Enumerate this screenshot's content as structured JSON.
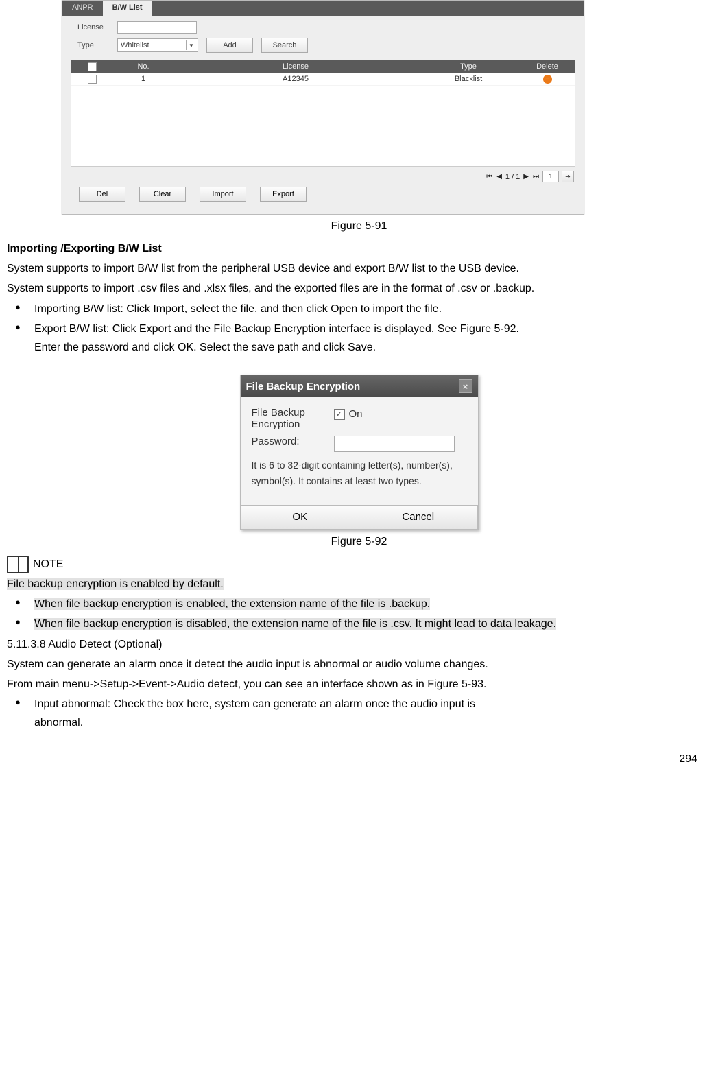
{
  "app": {
    "tabs": {
      "anpr": "ANPR",
      "bw": "B/W List"
    },
    "form": {
      "license_label": "License",
      "type_label": "Type",
      "type_value": "Whitelist",
      "add_btn": "Add",
      "search_btn": "Search"
    },
    "table": {
      "headers": {
        "no": "No.",
        "license": "License",
        "type": "Type",
        "delete": "Delete"
      },
      "row": {
        "no": "1",
        "license": "A12345",
        "type": "Blacklist"
      }
    },
    "pager": {
      "text": "1 / 1",
      "page": "1"
    },
    "buttons": {
      "del": "Del",
      "clear": "Clear",
      "import": "Import",
      "export": "Export"
    }
  },
  "captions": {
    "fig91": "Figure 5-91",
    "fig92": "Figure 5-92"
  },
  "text": {
    "h1": "Importing /Exporting B/W List",
    "p1": "System supports to import B/W list from the peripheral USB device and export B/W list to the USB device.",
    "p2": "System supports to import .csv files and .xlsx files, and the exported files are in the format of .csv or .backup.",
    "b1": "Importing B/W list: Click Import, select the file, and then click Open to import the file.",
    "b2a": "Export B/W list: Click Export and the File Backup Encryption interface is displayed. See Figure 5-92.",
    "b2b": "Enter the password and click OK. Select the save path and click Save.",
    "note_label": "NOTE",
    "note1": "File backup encryption is enabled by default.",
    "note2": "When file backup encryption is enabled, the extension name of the file is .backup.",
    "note3": "When file backup encryption is disabled, the extension name of the file is .csv. It might lead to data leakage.",
    "sec": "5.11.3.8  Audio Detect (Optional)",
    "p3": "System can generate an alarm once it detect the audio input is abnormal or audio volume changes.",
    "p4": "From main menu->Setup->Event->Audio detect, you can see an interface shown as in Figure 5-93.",
    "b3a": "Input abnormal: Check the box here, system can generate an alarm once the audio input is",
    "b3b": "abnormal."
  },
  "dialog": {
    "title": "File Backup Encryption",
    "row1_a": "File Backup",
    "row1_b": "Encryption",
    "on": "On",
    "pw": "Password:",
    "hint": "It is 6 to 32-digit containing letter(s), number(s), symbol(s). It contains at least two types.",
    "ok": "OK",
    "cancel": "Cancel"
  },
  "page_number": "294"
}
